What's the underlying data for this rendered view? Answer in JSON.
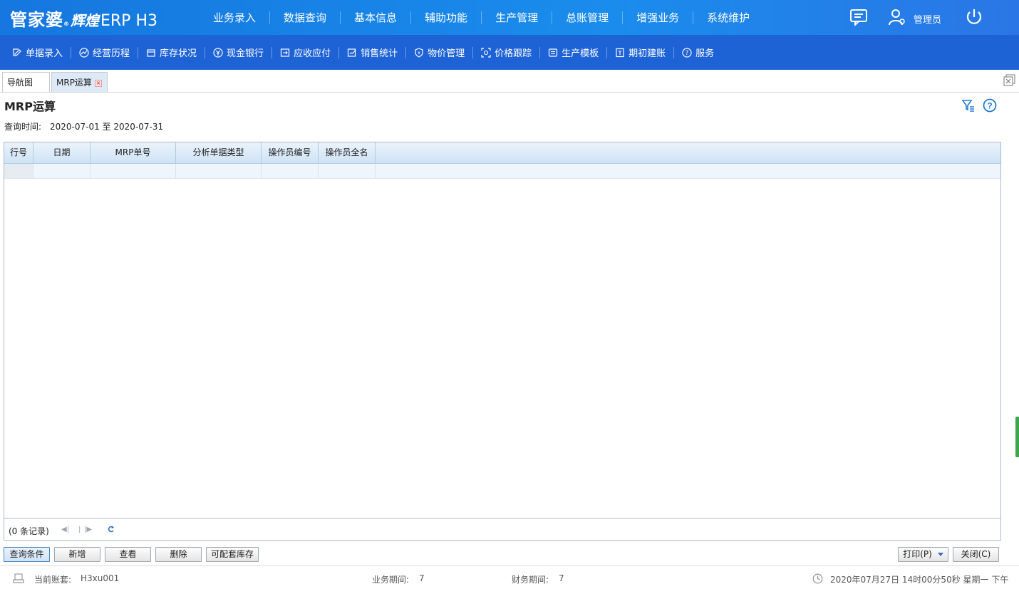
{
  "header": {
    "logo_brand": "管家婆",
    "logo_sub": "辉煌",
    "logo_reg": "®",
    "logo_product": "ERP H3",
    "nav": [
      "业务录入",
      "数据查询",
      "基本信息",
      "辅助功能",
      "生产管理",
      "总账管理",
      "增强业务",
      "系统维护"
    ],
    "username": "管理员"
  },
  "subnav": [
    {
      "label": "单据录入",
      "icon": "edit-icon"
    },
    {
      "label": "经营历程",
      "icon": "trend-icon"
    },
    {
      "label": "库存状况",
      "icon": "inventory-icon"
    },
    {
      "label": "现金银行",
      "icon": "yuan-icon"
    },
    {
      "label": "应收应付",
      "icon": "receivable-icon"
    },
    {
      "label": "销售统计",
      "icon": "sales-chart-icon"
    },
    {
      "label": "物价管理",
      "icon": "price-shield-icon"
    },
    {
      "label": "价格跟踪",
      "icon": "price-track-icon"
    },
    {
      "label": "生产模板",
      "icon": "template-icon"
    },
    {
      "label": "期初建账",
      "icon": "opening-account-icon"
    },
    {
      "label": "服务",
      "icon": "help-icon"
    }
  ],
  "tabs": {
    "nav_label": "导航图",
    "mrp_label": "MRP运算"
  },
  "page": {
    "title": "MRP运算",
    "query_label": "查询时间:",
    "query_value": "2020-07-01 至 2020-07-31"
  },
  "grid": {
    "columns": [
      "行号",
      "日期",
      "MRP单号",
      "分析单据类型",
      "操作员编号",
      "操作员全名"
    ],
    "record_count": "(0 条记录)"
  },
  "buttons": {
    "query": "查询条件",
    "add": "新增",
    "view": "查看",
    "delete": "删除",
    "stock": "可配套库存",
    "print": "打印(P)",
    "close": "关闭(C)"
  },
  "status": {
    "account_label": "当前账套:",
    "account_value": "H3xu001",
    "biz_period_label": "业务期间:",
    "biz_period_value": "7",
    "fin_period_label": "财务期间:",
    "fin_period_value": "7",
    "datetime": "2020年07月27日 14时00分50秒 星期一 下午"
  },
  "colors": {
    "topbar": "#1a8cec",
    "subbar": "#1e63d6",
    "grid_header": "#cfe3f6"
  }
}
